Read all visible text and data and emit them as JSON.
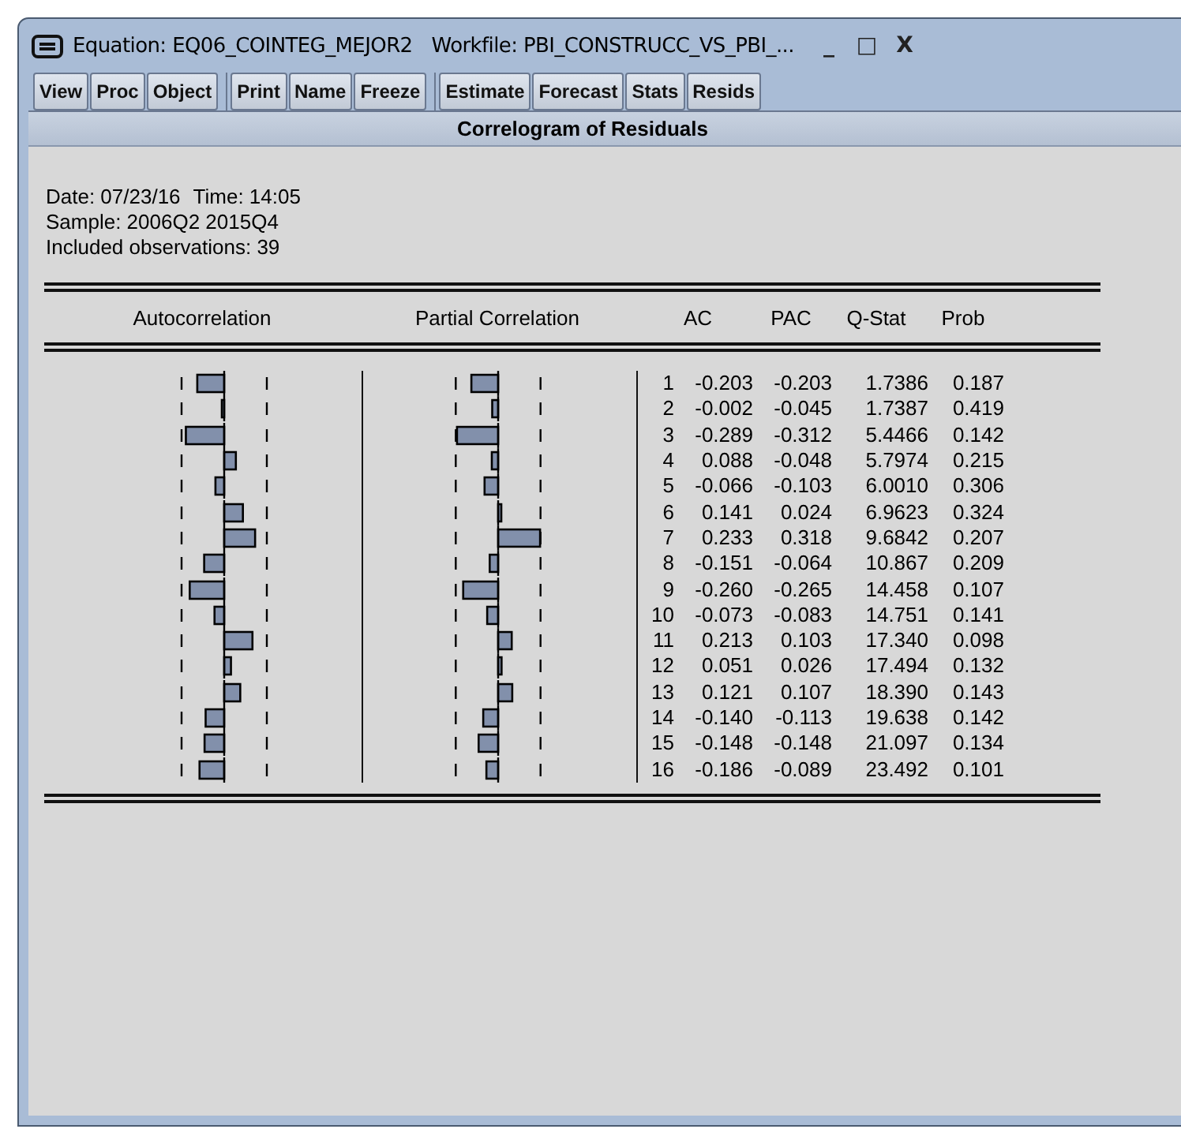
{
  "window": {
    "title": "Equation: EQ06_COINTEG_MEJOR2",
    "workfile": "Workfile: PBI_CONSTRUCC_VS_PBI_...",
    "controls": [
      "_",
      "□",
      "X"
    ]
  },
  "toolbar": [
    {
      "buttons": [
        "View",
        "Proc",
        "Object"
      ]
    },
    {
      "buttons": [
        "Print",
        "Name",
        "Freeze"
      ]
    },
    {
      "buttons": [
        "Estimate",
        "Forecast",
        "Stats",
        "Resids"
      ]
    }
  ],
  "view_title": "Correlogram of Residuals",
  "info": {
    "date": "Date: 07/23/16",
    "time": "Time: 14:05",
    "sample": "Sample: 2006Q2 2015Q4",
    "observations": "Included observations: 39"
  },
  "columns": [
    "Autocorrelation",
    "Partial Correlation",
    "AC",
    "PAC",
    "Q-Stat",
    "Prob"
  ],
  "rows": [
    {
      "lag": "1",
      "ac": "-0.203",
      "pac": "-0.203",
      "q_stat": "1.7386",
      "prob": "0.187"
    },
    {
      "lag": "2",
      "ac": "-0.002",
      "pac": "-0.045",
      "q_stat": "1.7387",
      "prob": "0.419"
    },
    {
      "lag": "3",
      "ac": "-0.289",
      "pac": "-0.312",
      "q_stat": "5.4466",
      "prob": "0.142"
    },
    {
      "lag": "4",
      "ac": "0.088",
      "pac": "-0.048",
      "q_stat": "5.7974",
      "prob": "0.215"
    },
    {
      "lag": "5",
      "ac": "-0.066",
      "pac": "-0.103",
      "q_stat": "6.0010",
      "prob": "0.306"
    },
    {
      "lag": "6",
      "ac": "0.141",
      "pac": "0.024",
      "q_stat": "6.9623",
      "prob": "0.324"
    },
    {
      "lag": "7",
      "ac": "0.233",
      "pac": "0.318",
      "q_stat": "9.6842",
      "prob": "0.207"
    },
    {
      "lag": "8",
      "ac": "-0.151",
      "pac": "-0.064",
      "q_stat": "10.867",
      "prob": "0.209"
    },
    {
      "lag": "9",
      "ac": "-0.260",
      "pac": "-0.265",
      "q_stat": "14.458",
      "prob": "0.107"
    },
    {
      "lag": "10",
      "ac": "-0.073",
      "pac": "-0.083",
      "q_stat": "14.751",
      "prob": "0.141"
    },
    {
      "lag": "11",
      "ac": "0.213",
      "pac": "0.103",
      "q_stat": "17.340",
      "prob": "0.098"
    },
    {
      "lag": "12",
      "ac": "0.051",
      "pac": "0.026",
      "q_stat": "17.494",
      "prob": "0.132"
    },
    {
      "lag": "13",
      "ac": "0.121",
      "pac": "0.107",
      "q_stat": "18.390",
      "prob": "0.143"
    },
    {
      "lag": "14",
      "ac": "-0.140",
      "pac": "-0.113",
      "q_stat": "19.638",
      "prob": "0.142"
    },
    {
      "lag": "15",
      "ac": "-0.148",
      "pac": "-0.148",
      "q_stat": "21.097",
      "prob": "0.134"
    },
    {
      "lag": "16",
      "ac": "-0.186",
      "pac": "-0.089",
      "q_stat": "23.492",
      "prob": "0.101"
    }
  ]
}
